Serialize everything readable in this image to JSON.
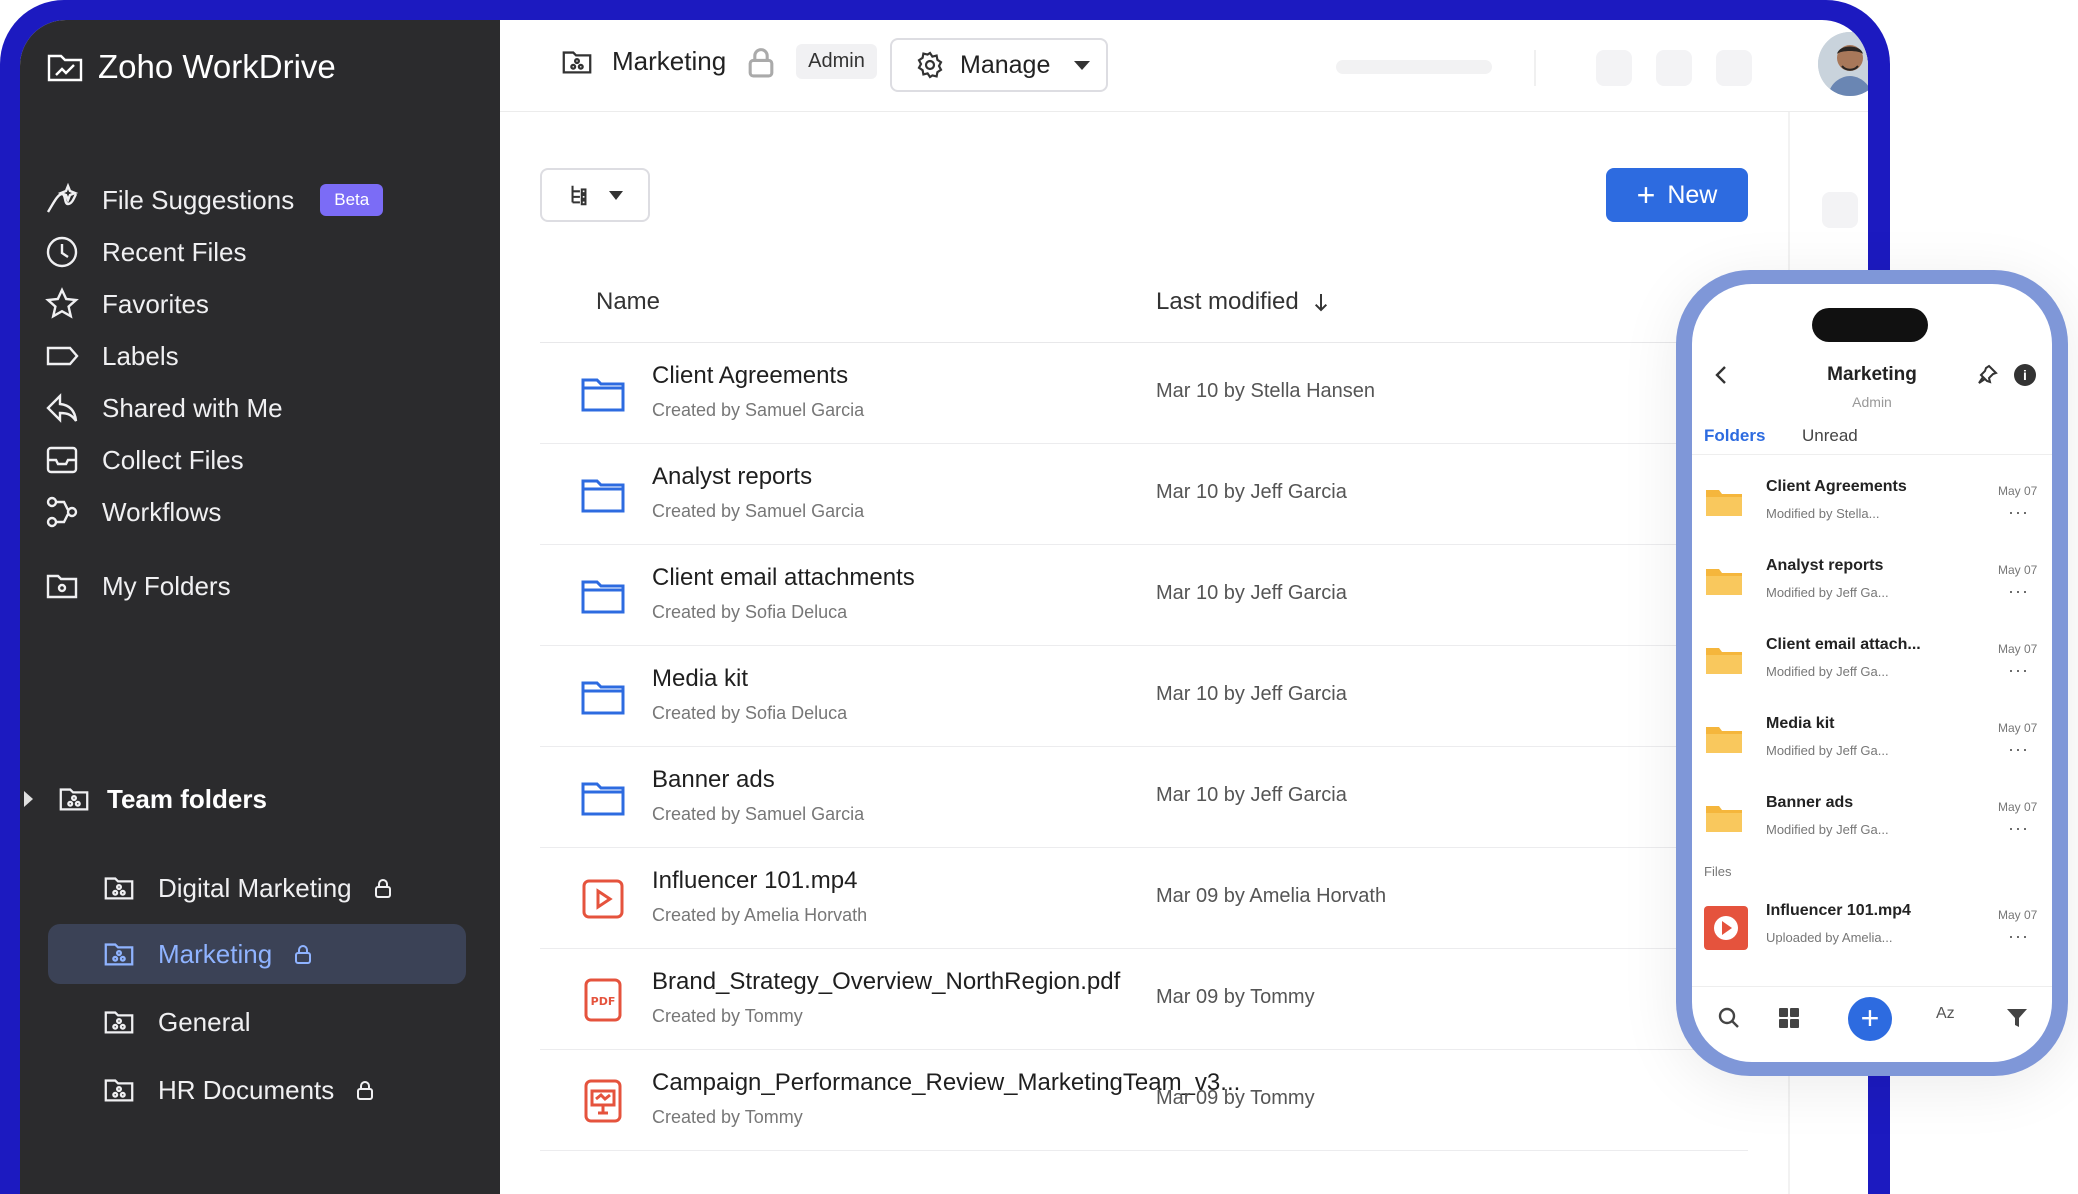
{
  "app": {
    "title": "Zoho WorkDrive"
  },
  "sidebar": {
    "items": [
      {
        "label": "File Suggestions",
        "icon": "sparkle-icon",
        "badge": "Beta"
      },
      {
        "label": "Recent Files",
        "icon": "clock-icon"
      },
      {
        "label": "Favorites",
        "icon": "star-icon"
      },
      {
        "label": "Labels",
        "icon": "label-icon"
      },
      {
        "label": "Shared with Me",
        "icon": "share-icon"
      },
      {
        "label": "Collect Files",
        "icon": "inbox-icon"
      },
      {
        "label": "Workflows",
        "icon": "workflow-icon"
      },
      {
        "label": "My Folders",
        "icon": "folder-icon"
      }
    ],
    "team_folders": {
      "label": "Team folders",
      "items": [
        {
          "label": "Digital Marketing",
          "locked": true
        },
        {
          "label": "Marketing",
          "locked": true,
          "active": true
        },
        {
          "label": "General",
          "locked": false
        },
        {
          "label": "HR Documents",
          "locked": true
        }
      ]
    }
  },
  "header": {
    "folder": "Marketing",
    "role": "Admin",
    "manage_label": "Manage"
  },
  "toolbar": {
    "new_label": "New"
  },
  "table": {
    "columns": {
      "name": "Name",
      "modified": "Last modified"
    },
    "rows": [
      {
        "name": "Client Agreements",
        "created": "Created by Samuel Garcia",
        "modified": "Mar 10 by Stella Hansen",
        "type": "folder"
      },
      {
        "name": "Analyst reports",
        "created": "Created by Samuel Garcia",
        "modified": "Mar 10 by Jeff Garcia",
        "type": "folder"
      },
      {
        "name": "Client email attachments",
        "created": "Created by Sofia Deluca",
        "modified": "Mar 10 by Jeff Garcia",
        "type": "folder"
      },
      {
        "name": "Media kit",
        "created": "Created by Sofia Deluca",
        "modified": "Mar 10 by Jeff Garcia",
        "type": "folder"
      },
      {
        "name": "Banner ads",
        "created": "Created by Samuel Garcia",
        "modified": "Mar 10 by Jeff Garcia",
        "type": "folder"
      },
      {
        "name": "Influencer 101.mp4",
        "created": "Created by Amelia Horvath",
        "modified": "Mar 09 by Amelia Horvath",
        "type": "video"
      },
      {
        "name": "Brand_Strategy_Overview_NorthRegion.pdf",
        "created": "Created by Tommy",
        "modified": "Mar 09 by Tommy",
        "type": "pdf"
      },
      {
        "name": "Campaign_Performance_Review_MarketingTeam_v3...",
        "created": "Created by Tommy",
        "modified": "Mar 09 by Tommy",
        "type": "presentation"
      }
    ]
  },
  "phone": {
    "title": "Marketing",
    "role": "Admin",
    "tabs": [
      "Folders",
      "Unread"
    ],
    "items": [
      {
        "name": "Client Agreements",
        "sub": "Modified by Stella...",
        "date": "May 07"
      },
      {
        "name": "Analyst reports",
        "sub": "Modified by Jeff Ga...",
        "date": "May 07"
      },
      {
        "name": "Client email attach...",
        "sub": "Modified by Jeff Ga...",
        "date": "May 07"
      },
      {
        "name": "Media kit",
        "sub": "Modified by Jeff Ga...",
        "date": "May 07"
      },
      {
        "name": "Banner ads",
        "sub": "Modified by Jeff Ga...",
        "date": "May 07"
      }
    ],
    "files_label": "Files",
    "file": {
      "name": "Influencer 101.mp4",
      "sub": "Uploaded by Amelia...",
      "date": "May 07"
    },
    "bottom": {
      "sort_label": "Az"
    }
  },
  "colors": {
    "frame": "#1c1ac0",
    "sidebar": "#2b2b2d",
    "accent": "#2d6be0",
    "active_item": "#3b4256",
    "beta": "#7b6cf6",
    "file_red": "#e5533d",
    "folder_yellow": "#f5b63c"
  }
}
